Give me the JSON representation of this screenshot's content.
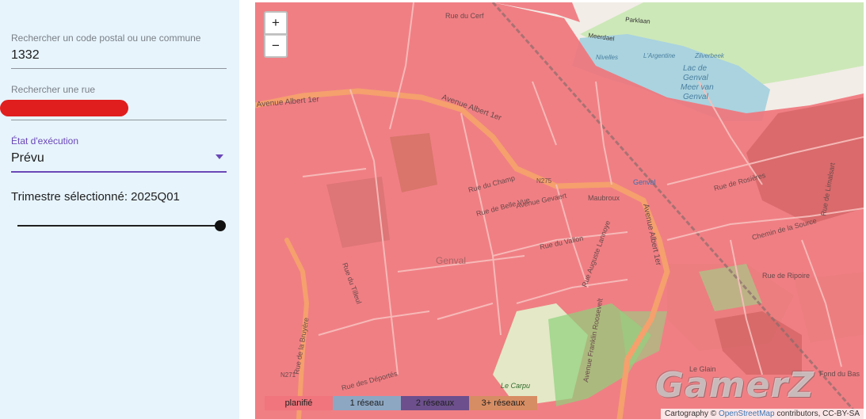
{
  "sidebar": {
    "postal": {
      "label": "Rechercher un code postal ou une commune",
      "value": "1332"
    },
    "street": {
      "label": "Rechercher une rue"
    },
    "status": {
      "label": "État d'exécution",
      "value": "Prévu"
    },
    "quarter_text": "Trimestre sélectionné: 2025Q01",
    "quarter_slider_level": 1.0
  },
  "map": {
    "zoom_in": "+",
    "zoom_out": "−",
    "legend": [
      {
        "label": "planifié",
        "color": "#f0757c"
      },
      {
        "label": "1 réseau",
        "color": "#8da7c3"
      },
      {
        "label": "2 réseaux",
        "color": "#6c4f8c"
      },
      {
        "label": "3+ réseaux",
        "color": "#d78d63"
      }
    ],
    "attribution": {
      "prefix": "Cartography ©",
      "osm": "OpenStreetMap",
      "suffix": "contributors, CC-BY-SA"
    },
    "labels": {
      "avenue_albert_1er_a": "Avenue Albert 1er",
      "avenue_albert_1er_b": "Avenue Albert 1er",
      "avenue_albert_1er_c": "Avenue Albert 1er",
      "rue_du_cerf": "Rue du Cerf",
      "lac_de_genval": "Lac de",
      "lac_de_genval_2": "Genval",
      "meer_van": "Meer van",
      "genval_water": "Genval",
      "parklaan": "Parklaan",
      "meerdael": "Meerdael",
      "nivelles": "Nivelles",
      "argentine": "L'Argentine",
      "zilverbeek": "Zilverbeek",
      "n275": "N275",
      "genval_station": "Genval",
      "maubroux": "Maubroux",
      "rue_de_rosieres": "Rue de Rosières",
      "rue_du_vallon": "Rue du Vallon",
      "genval_town": "Genval",
      "rue_auguste_lannoye": "Rue Auguste Lannoye",
      "avenue_franklin_roosevelt": "Avenue Franklin Roosevelt",
      "le_carpu": "Le Carpu",
      "le_glain": "Le Glain",
      "n271": "N271",
      "rue_de_la_bruyere": "Rue de la Bruyère",
      "rue_des_deportes": "Rue des Déportés",
      "rue_du_tilleul": "Rue du Tilleul",
      "rue_de_ripoire": "Rue de Ripoire",
      "fond_du_bas": "Fond du Bas",
      "rue_du_champ": "Rue du Champ",
      "avenue_gevaert": "Avenue Gevaert",
      "rue_de_belle_vue": "Rue de Belle Vue",
      "chemin_de_la_source": "Chemin de la Source",
      "rue_de_limalsart": "Rue de Limalsart"
    },
    "watermark": "GamerZ"
  }
}
